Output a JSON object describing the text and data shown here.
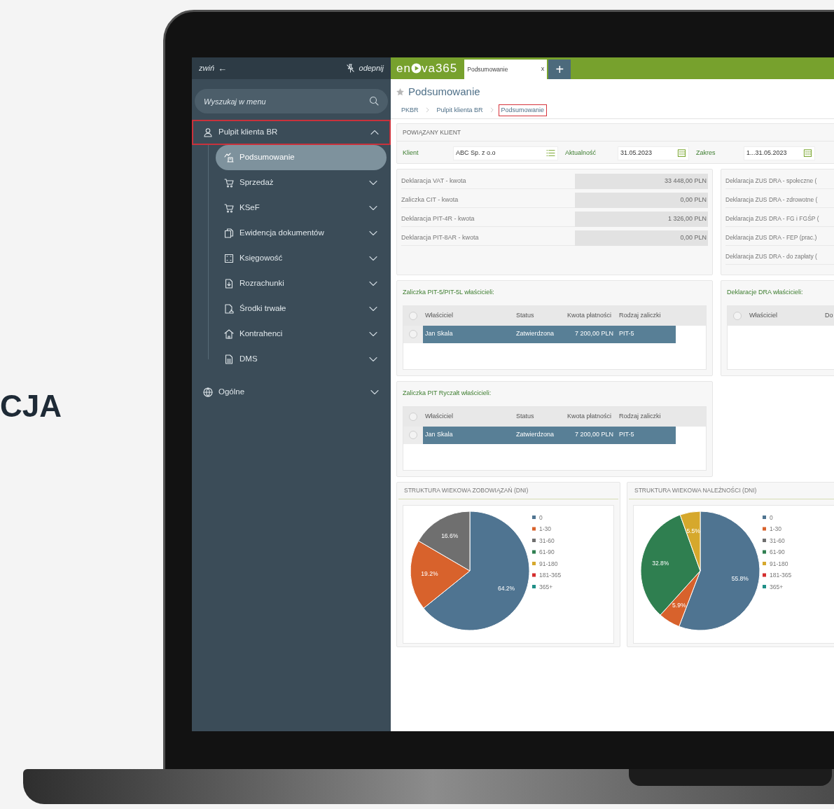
{
  "heading": "CJA",
  "sidebar": {
    "collapse": {
      "label": "zwiń",
      "arrow": "←"
    },
    "unpin": "odepnij",
    "search": {
      "placeholder": "Wyszukaj w menu"
    },
    "groups": [
      {
        "label": "Pulpit klienta BR",
        "expanded": true,
        "highlighted": true,
        "children": [
          {
            "label": "Podsumowanie",
            "selected": true,
            "expandable": false
          },
          {
            "label": "Sprzedaż",
            "selected": false,
            "expandable": true
          },
          {
            "label": "KSeF",
            "selected": false,
            "expandable": true
          },
          {
            "label": "Ewidencja dokumentów",
            "selected": false,
            "expandable": true
          },
          {
            "label": "Księgowość",
            "selected": false,
            "expandable": true
          },
          {
            "label": "Rozrachunki",
            "selected": false,
            "expandable": true
          },
          {
            "label": "Środki trwałe",
            "selected": false,
            "expandable": true
          },
          {
            "label": "Kontrahenci",
            "selected": false,
            "expandable": true
          },
          {
            "label": "DMS",
            "selected": false,
            "expandable": true
          }
        ]
      },
      {
        "label": "Ogólne",
        "expanded": false,
        "highlighted": false
      }
    ]
  },
  "app_bar": {
    "logo": {
      "start": "en",
      "end": "va365"
    },
    "tabs": [
      {
        "label": "Podsumowanie",
        "close": "x",
        "selected": true
      }
    ],
    "add": "+"
  },
  "page_title": "Podsumowanie",
  "breadcrumb": [
    {
      "label": "PKBR",
      "highlighted": false
    },
    {
      "label": "Pulpit klienta BR",
      "highlighted": false
    },
    {
      "label": "Podsumowanie",
      "highlighted": true
    }
  ],
  "client_panel": {
    "title": "POWIĄZANY KLIENT",
    "fields": [
      {
        "label": "Klient",
        "value": "ABC Sp. z o.o",
        "kind": "list"
      },
      {
        "label": "Aktualność",
        "value": "31.05.2023",
        "kind": "date"
      },
      {
        "label": "Zakres",
        "value": "1...31.05.2023",
        "kind": "date"
      }
    ]
  },
  "amounts": [
    {
      "label": "Deklaracja VAT - kwota",
      "value": "33 448,00 PLN"
    },
    {
      "label": "Zaliczka CIT - kwota",
      "value": "0,00 PLN"
    },
    {
      "label": "Deklaracja PIT-4R - kwota",
      "value": "1 326,00 PLN"
    },
    {
      "label": "Deklaracja PIT-8AR - kwota",
      "value": "0,00 PLN"
    }
  ],
  "zus": [
    "Deklaracja ZUS DRA - społeczne (",
    "Deklaracja ZUS DRA - zdrowotne (",
    "Deklaracja ZUS DRA - FG i FGŚP (",
    "Deklaracja ZUS DRA - FEP (prac.)",
    "Deklaracja ZUS DRA - do zapłaty ("
  ],
  "tables": [
    {
      "title": "Zaliczka PIT-5/PIT-5L właścicieli:",
      "header_checked": false,
      "columns": [
        "Właściciel",
        "Status",
        "Kwota płatności",
        "Rodzaj zaliczki"
      ],
      "rows": [
        {
          "cells": [
            "Jan Skala",
            "Zatwierdzona",
            "7 200,00 PLN",
            "PIT-5"
          ],
          "selected": true,
          "checked": false
        }
      ]
    },
    {
      "title": "Zaliczka PIT Ryczałt właścicieli:",
      "header_checked": false,
      "columns": [
        "Właściciel",
        "Status",
        "Kwota płatności",
        "Rodzaj zaliczki"
      ],
      "rows": [
        {
          "cells": [
            "Jan Skala",
            "Zatwierdzona",
            "7 200,00 PLN",
            "PIT-5"
          ],
          "selected": true,
          "checked": false
        }
      ]
    }
  ],
  "dra_table": {
    "title": "Deklaracje DRA właścicieli:",
    "header_checked": false,
    "columns": [
      "Właściciel",
      "Do"
    ]
  },
  "charts": [
    {
      "title": "STRUKTURA WIEKOWA ZOBOWIĄZAŃ (DNI)",
      "chart_data": {
        "type": "pie",
        "categories": [
          "0",
          "1-30",
          "31-60",
          "61-90",
          "91-180",
          "181-365",
          "365+"
        ],
        "legend": "right",
        "values": [
          64.2,
          19.2,
          16.6,
          0,
          0,
          0,
          0
        ],
        "value_labels": [
          "64.2%",
          "19.2%",
          "16.6%",
          null,
          null,
          null,
          null
        ]
      }
    },
    {
      "title": "STRUKTURA WIEKOWA NALEŻNOŚCI (DNI)",
      "chart_data": {
        "type": "pie",
        "categories": [
          "0",
          "1-30",
          "31-60",
          "61-90",
          "91-180",
          "181-365",
          "365+"
        ],
        "legend": "right",
        "values": [
          55.8,
          5.9,
          0,
          32.8,
          5.5,
          0,
          0
        ],
        "value_labels": [
          "55.8%",
          "5.9%",
          null,
          "32.8%",
          "5.5%",
          null,
          null
        ]
      }
    }
  ]
}
